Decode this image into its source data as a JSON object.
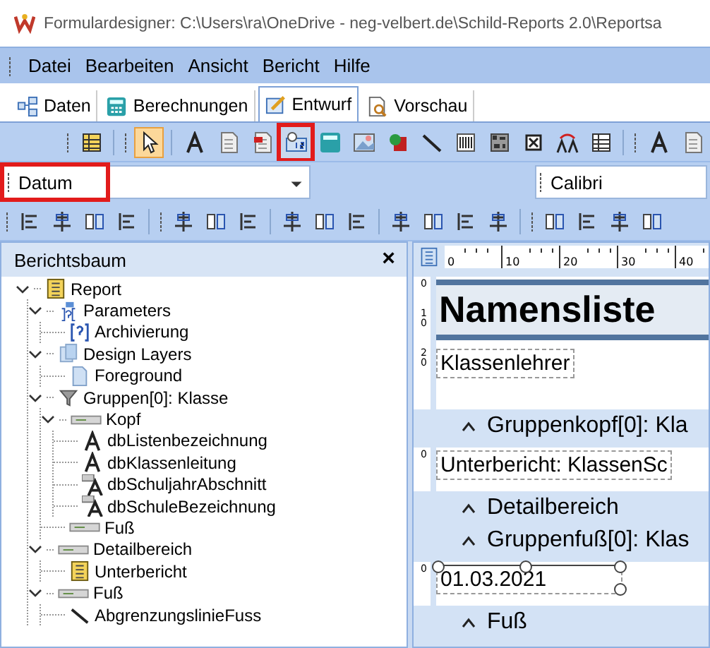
{
  "window": {
    "title": "Formulardesigner: C:\\Users\\ra\\OneDrive - neg-velbert.de\\Schild-Reports 2.0\\Reportsa"
  },
  "menu": [
    "Datei",
    "Bearbeiten",
    "Ansicht",
    "Bericht",
    "Hilfe"
  ],
  "tabs": [
    {
      "label": "Daten",
      "kind": "data",
      "selected": false
    },
    {
      "label": "Berechnungen",
      "kind": "calc",
      "selected": false
    },
    {
      "label": "Entwurf",
      "kind": "design",
      "selected": true
    },
    {
      "label": "Vorschau",
      "kind": "preview",
      "selected": false
    }
  ],
  "tools": [
    {
      "selected": false,
      "highlighted": false
    },
    {
      "selected": true,
      "highlighted": false
    },
    {
      "selected": false,
      "highlighted": false
    },
    {
      "selected": false,
      "highlighted": false
    },
    {
      "selected": false,
      "highlighted": false
    },
    {
      "selected": false,
      "highlighted": true
    },
    {
      "selected": false,
      "highlighted": false
    },
    {
      "selected": false,
      "highlighted": false
    },
    {
      "selected": false,
      "highlighted": false
    },
    {
      "selected": false,
      "highlighted": false
    },
    {
      "selected": false,
      "highlighted": false
    },
    {
      "selected": false,
      "highlighted": false
    },
    {
      "selected": false,
      "highlighted": false
    },
    {
      "selected": false,
      "highlighted": false
    },
    {
      "selected": false,
      "highlighted": false
    },
    {
      "selected": false,
      "highlighted": false
    },
    {
      "selected": false,
      "highlighted": false
    }
  ],
  "field_combo": {
    "value": "Datum",
    "highlighted": true
  },
  "font_combo": {
    "value": "Calibri"
  },
  "tree": {
    "title": "Berichtsbaum",
    "close": "×",
    "nodes": [
      {
        "label": "Report",
        "kind": "report",
        "expanded": true,
        "children": [
          {
            "label": "Parameters",
            "kind": "params",
            "expanded": true,
            "children": [
              {
                "label": "Archivierung",
                "kind": "param"
              }
            ]
          },
          {
            "label": "Design Layers",
            "kind": "layers",
            "expanded": true,
            "children": [
              {
                "label": "Foreground",
                "kind": "layer"
              }
            ]
          },
          {
            "label": "Gruppen[0]: Klasse",
            "kind": "group",
            "expanded": true,
            "children": [
              {
                "label": "Kopf",
                "kind": "band",
                "expanded": true,
                "children": [
                  {
                    "label": "dbListenbezeichnung",
                    "kind": "text"
                  },
                  {
                    "label": "dbKlassenleitung",
                    "kind": "text"
                  },
                  {
                    "label": "dbSchuljahrAbschnitt",
                    "kind": "dbtext"
                  },
                  {
                    "label": "dbSchuleBezeichnung",
                    "kind": "dbtext"
                  }
                ]
              },
              {
                "label": "Fuß",
                "kind": "band"
              }
            ]
          },
          {
            "label": "Detailbereich",
            "kind": "band",
            "expanded": true,
            "children": [
              {
                "label": "Unterbericht",
                "kind": "report"
              }
            ]
          },
          {
            "label": "Fuß",
            "kind": "band",
            "expanded": true,
            "children": [
              {
                "label": "AbgrenzungslinieFuss",
                "kind": "line"
              }
            ]
          }
        ]
      }
    ]
  },
  "design": {
    "ruler": [
      "0",
      "10",
      "20",
      "30",
      "40"
    ],
    "sections": [
      {
        "kind": "band",
        "ruler": [
          "0",
          "10",
          "20"
        ],
        "items": [
          {
            "kind": "title",
            "text": "Namensliste"
          },
          {
            "kind": "field",
            "text": "Klassenlehrer"
          }
        ]
      },
      {
        "kind": "divider",
        "label": "Gruppenkopf[0]: Kla"
      },
      {
        "kind": "band",
        "ruler": [
          "0"
        ],
        "items": [
          {
            "kind": "field",
            "text": "Unterbericht: KlassenSc"
          }
        ]
      },
      {
        "kind": "divider",
        "label": "Detailbereich"
      },
      {
        "kind": "divider",
        "label": "Gruppenfuß[0]: Klas"
      },
      {
        "kind": "band",
        "ruler": [
          "0"
        ],
        "items": [
          {
            "kind": "selected_field",
            "text": "01.03.2021"
          }
        ]
      },
      {
        "kind": "divider",
        "label": "Fuß"
      }
    ]
  }
}
